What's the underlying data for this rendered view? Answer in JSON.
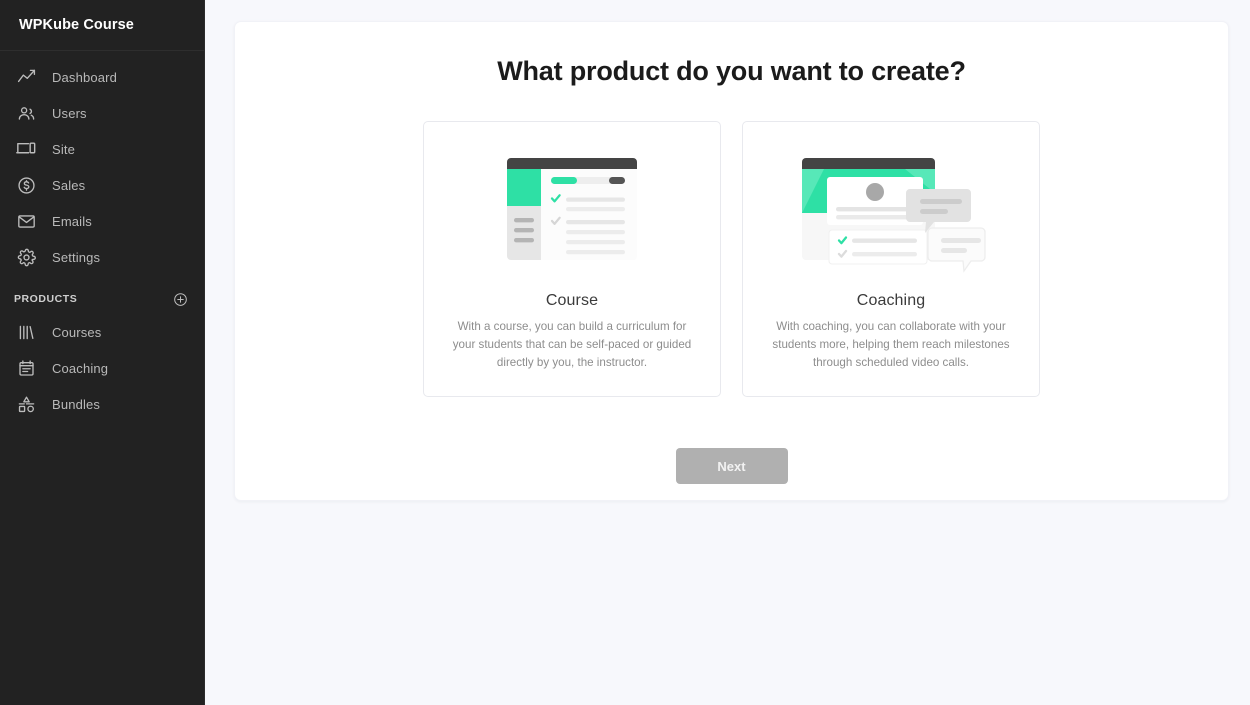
{
  "sidebar": {
    "brand": "WPKube Course",
    "nav": [
      {
        "label": "Dashboard",
        "icon": "chart-line-icon"
      },
      {
        "label": "Users",
        "icon": "users-icon"
      },
      {
        "label": "Site",
        "icon": "devices-icon"
      },
      {
        "label": "Sales",
        "icon": "dollar-circle-icon"
      },
      {
        "label": "Emails",
        "icon": "envelope-icon"
      },
      {
        "label": "Settings",
        "icon": "gear-icon"
      }
    ],
    "products_section": {
      "title": "PRODUCTS",
      "add_icon": "plus-circle-icon",
      "items": [
        {
          "label": "Courses",
          "icon": "books-icon"
        },
        {
          "label": "Coaching",
          "icon": "notepad-icon"
        },
        {
          "label": "Bundles",
          "icon": "shapes-icon"
        }
      ]
    }
  },
  "main": {
    "title": "What product do you want to create?",
    "cards": [
      {
        "title": "Course",
        "description": "With a course, you can build a curriculum for your students that can be self-paced or guided directly by you, the instructor.",
        "illustration": "course-illustration"
      },
      {
        "title": "Coaching",
        "description": "With coaching, you can collaborate with your students more, helping them reach milestones through scheduled video calls.",
        "illustration": "coaching-illustration"
      }
    ],
    "next_label": "Next"
  },
  "colors": {
    "sidebar_bg": "#222222",
    "page_bg": "#f7f8fc",
    "accent_green": "#2ee0a5",
    "button_disabled": "#b0b0b0",
    "illustration_dark": "#444444"
  }
}
